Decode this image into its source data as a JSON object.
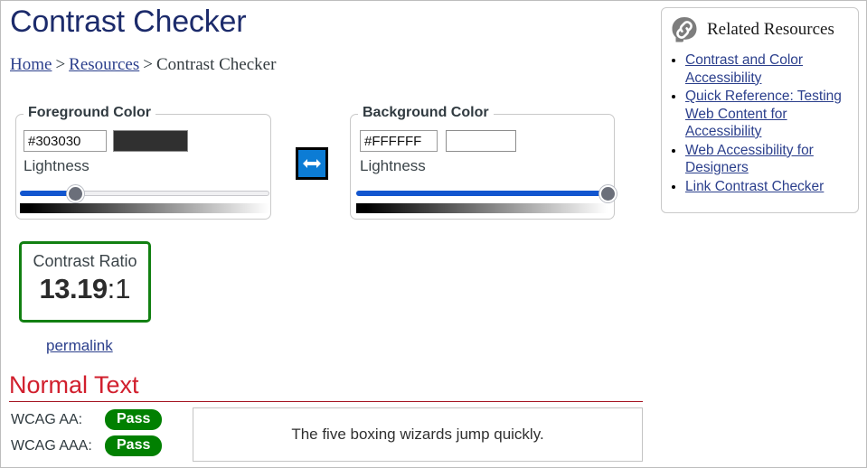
{
  "page": {
    "title": "Contrast Checker"
  },
  "breadcrumb": {
    "home": "Home",
    "sep1": ">",
    "resources": "Resources",
    "sep2": ">",
    "current": "Contrast Checker"
  },
  "foreground": {
    "legend": "Foreground Color",
    "hex_value": "#303030",
    "swatch_color": "#303030",
    "lightness_label": "Lightness",
    "lightness_percent": 22
  },
  "background": {
    "legend": "Background Color",
    "hex_value": "#FFFFFF",
    "swatch_color": "#FFFFFF",
    "lightness_label": "Lightness",
    "lightness_percent": 100
  },
  "swap": {
    "icon": "left-right-arrow-icon",
    "button_color": "#0c7cd5"
  },
  "result": {
    "ratio_label": "Contrast Ratio",
    "ratio_value": "13.19",
    "ratio_suffix": ":1",
    "border_color": "#128012",
    "permalink": "permalink"
  },
  "normal_text": {
    "heading": "Normal Text",
    "heading_color": "#d11f2d",
    "rows": [
      {
        "label": "WCAG AA:",
        "status": "Pass"
      },
      {
        "label": "WCAG AAA:",
        "status": "Pass"
      }
    ],
    "pass_color": "#018001",
    "sample_text": "The five boxing wizards jump quickly."
  },
  "related_resources": {
    "icon": "head-link-icon",
    "title": "Related Resources",
    "links": [
      "Contrast and Color Accessibility",
      "Quick Reference: Testing Web Content for Accessibility",
      "Web Accessibility for Designers",
      "Link Contrast Checker"
    ]
  }
}
